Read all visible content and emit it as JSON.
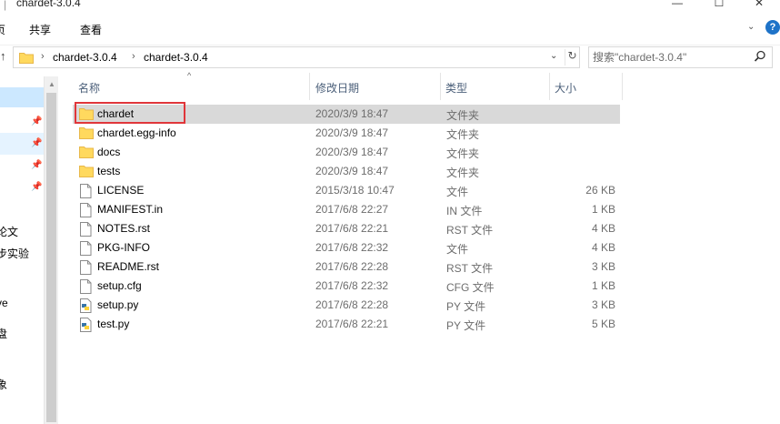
{
  "window": {
    "title": "chardet-3.0.4",
    "minimize_glyph": "—",
    "maximize_glyph": "☐",
    "close_glyph": "✕"
  },
  "ribbon": {
    "tabs": [
      "页",
      "共享",
      "查看"
    ],
    "collapse_glyph": "⌄",
    "help_glyph": "?"
  },
  "nav": {
    "up_glyph": "↑",
    "breadcrumbs": [
      "chardet-3.0.4",
      "chardet-3.0.4"
    ],
    "chevron": "›",
    "dropdown_glyph": "⌄",
    "refresh_glyph": "↻",
    "search_placeholder": "搜索\"chardet-3.0.4\""
  },
  "sidebar": {
    "items": [
      {
        "text": "",
        "pinned": false
      },
      {
        "text": "",
        "pinned": true
      },
      {
        "text": "",
        "pinned": true
      },
      {
        "text": "",
        "pinned": true
      },
      {
        "text": "",
        "pinned": true
      },
      {
        "text": "论文",
        "pinned": false
      },
      {
        "text": "步实验",
        "pinned": false
      },
      {
        "text": "ve",
        "pinned": false
      },
      {
        "text": "盘",
        "pinned": false
      },
      {
        "text": "象",
        "pinned": false
      }
    ],
    "pin_glyph": "📌"
  },
  "columns": {
    "name": "名称",
    "date": "修改日期",
    "type": "类型",
    "size": "大小",
    "sort_glyph": "^"
  },
  "files": [
    {
      "name": "chardet",
      "date": "2020/3/9 18:47",
      "type": "文件夹",
      "size": "",
      "icon": "folder-icon",
      "selected": true
    },
    {
      "name": "chardet.egg-info",
      "date": "2020/3/9 18:47",
      "type": "文件夹",
      "size": "",
      "icon": "folder-icon",
      "selected": false
    },
    {
      "name": "docs",
      "date": "2020/3/9 18:47",
      "type": "文件夹",
      "size": "",
      "icon": "folder-icon",
      "selected": false
    },
    {
      "name": "tests",
      "date": "2020/3/9 18:47",
      "type": "文件夹",
      "size": "",
      "icon": "folder-icon",
      "selected": false
    },
    {
      "name": "LICENSE",
      "date": "2015/3/18 10:47",
      "type": "文件",
      "size": "26 KB",
      "icon": "file-icon",
      "selected": false
    },
    {
      "name": "MANIFEST.in",
      "date": "2017/6/8 22:27",
      "type": "IN 文件",
      "size": "1 KB",
      "icon": "file-icon",
      "selected": false
    },
    {
      "name": "NOTES.rst",
      "date": "2017/6/8 22:21",
      "type": "RST 文件",
      "size": "4 KB",
      "icon": "file-icon",
      "selected": false
    },
    {
      "name": "PKG-INFO",
      "date": "2017/6/8 22:32",
      "type": "文件",
      "size": "4 KB",
      "icon": "file-icon",
      "selected": false
    },
    {
      "name": "README.rst",
      "date": "2017/6/8 22:28",
      "type": "RST 文件",
      "size": "3 KB",
      "icon": "file-icon",
      "selected": false
    },
    {
      "name": "setup.cfg",
      "date": "2017/6/8 22:32",
      "type": "CFG 文件",
      "size": "1 KB",
      "icon": "file-icon",
      "selected": false
    },
    {
      "name": "setup.py",
      "date": "2017/6/8 22:28",
      "type": "PY 文件",
      "size": "3 KB",
      "icon": "python-file-icon",
      "selected": false
    },
    {
      "name": "test.py",
      "date": "2017/6/8 22:21",
      "type": "PY 文件",
      "size": "5 KB",
      "icon": "python-file-icon",
      "selected": false
    }
  ],
  "colors": {
    "folder": "#ffd95e",
    "folder_dark": "#e8b84a",
    "selection": "#d9d9d9",
    "highlight_box": "#e0363a",
    "python_blue": "#3775a9",
    "python_yellow": "#ffd43b"
  }
}
